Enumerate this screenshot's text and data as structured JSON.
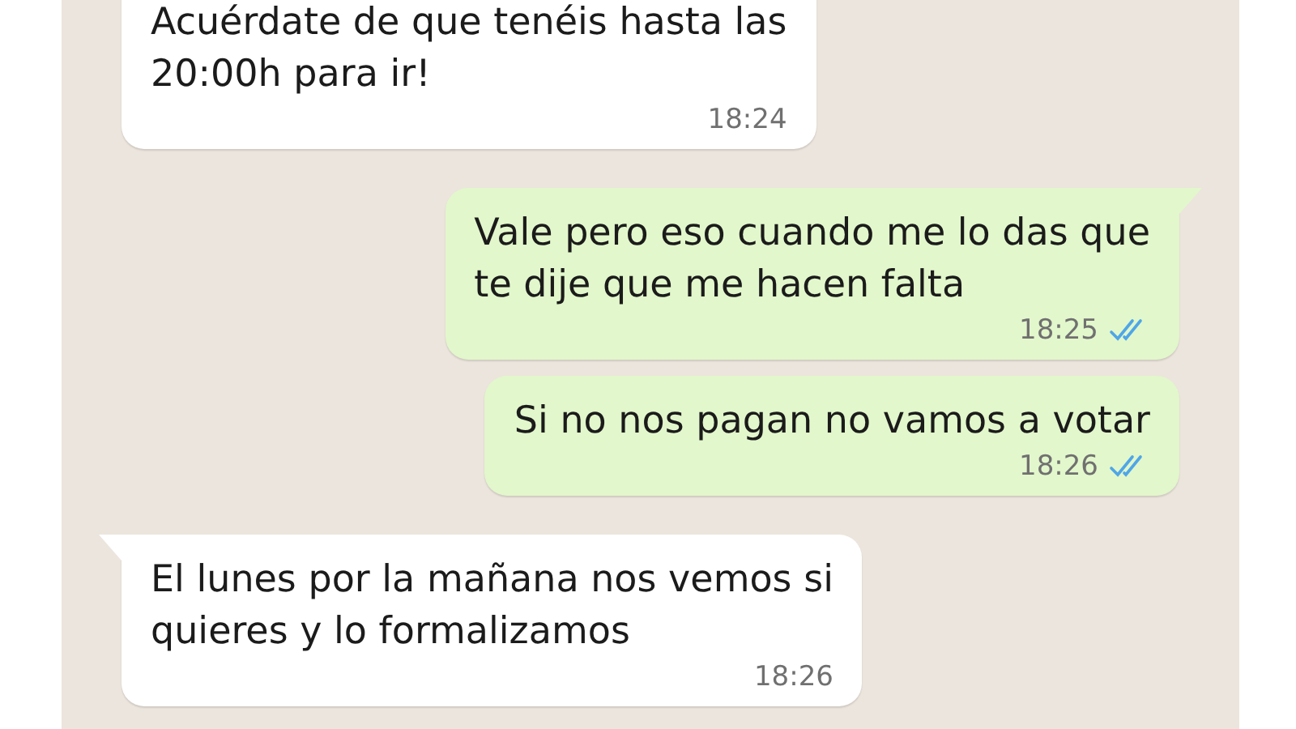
{
  "messages": [
    {
      "outgoing": false,
      "lines": [
        "Acuérdate de que tenéis hasta las",
        "20:00h para ir!"
      ],
      "time": "18:24",
      "tail": false
    },
    {
      "outgoing": true,
      "lines": [
        "Vale pero eso cuando me lo das que",
        "te dije que me hacen falta"
      ],
      "time": "18:25",
      "read": true,
      "tail": true
    },
    {
      "outgoing": true,
      "lines": [
        "Si no nos pagan no vamos a votar"
      ],
      "time": "18:26",
      "read": true,
      "tail": false
    },
    {
      "outgoing": false,
      "lines": [
        "El lunes por la mañana nos vemos si",
        "quieres y lo formalizamos"
      ],
      "time": "18:26",
      "tail": true
    }
  ]
}
